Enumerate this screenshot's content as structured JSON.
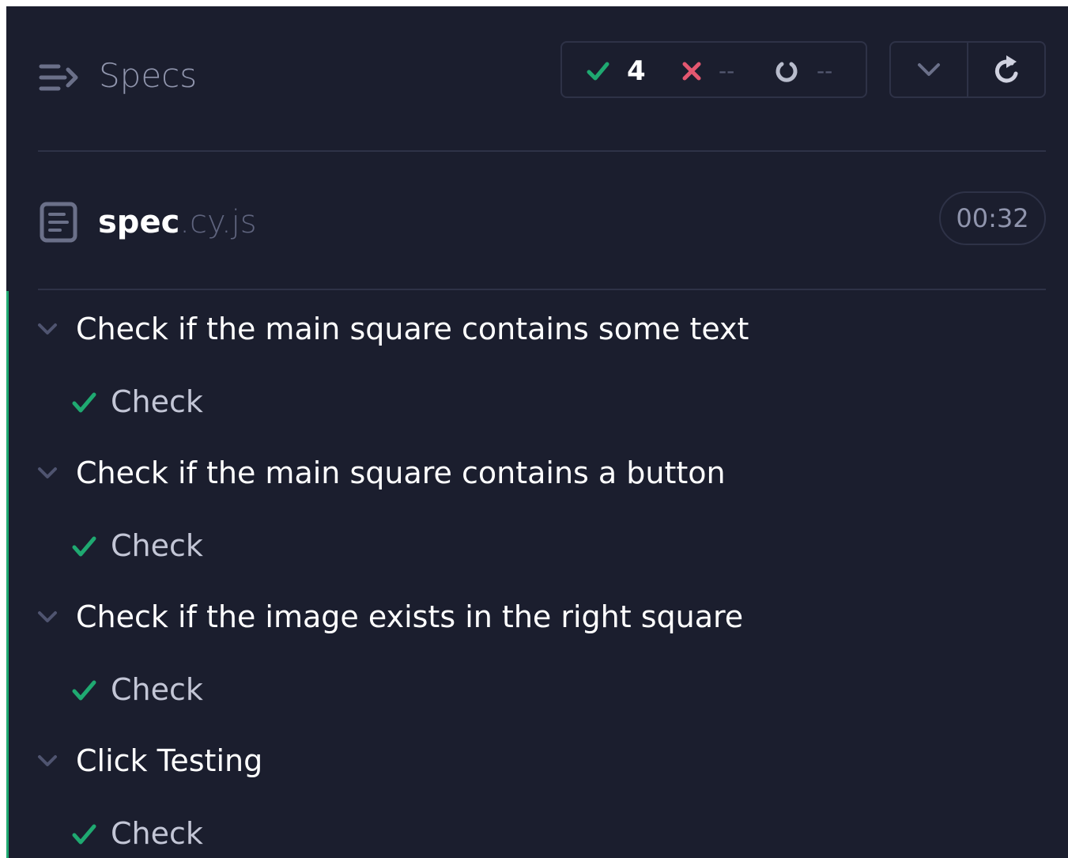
{
  "header": {
    "title": "Specs",
    "stats": {
      "passed": "4",
      "failed": "--",
      "pending": "--"
    }
  },
  "spec": {
    "name": "spec",
    "extension": ".cy.js",
    "duration": "00:32"
  },
  "suites": [
    {
      "title": "Check if the main square contains some text",
      "test": "Check"
    },
    {
      "title": "Check if the main square contains a button",
      "test": "Check"
    },
    {
      "title": "Check if the image exists in the right square",
      "test": "Check"
    },
    {
      "title": "Click Testing",
      "test": "Check"
    }
  ],
  "colors": {
    "background": "#1b1e2e",
    "pass": "#1fa971",
    "fail": "#e45770",
    "border": "#2e3247"
  },
  "icons": {
    "header": "specs-list-icon",
    "passed": "check-icon",
    "failed": "x-icon",
    "pending": "spinner-icon",
    "collapse": "chevron-down-icon",
    "rerun": "refresh-icon",
    "file": "document-icon"
  }
}
